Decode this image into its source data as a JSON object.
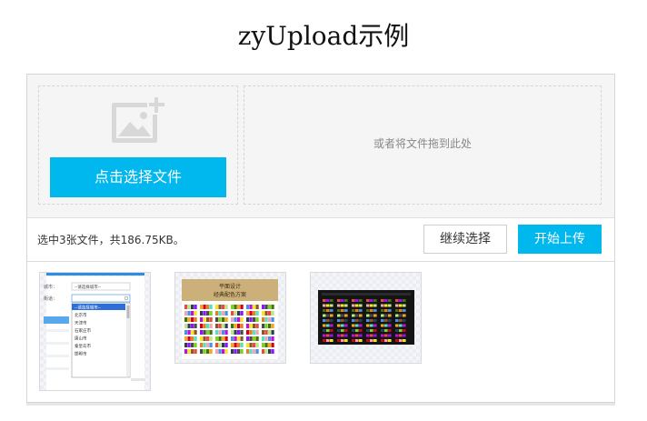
{
  "page": {
    "title": "zyUpload示例"
  },
  "uploader": {
    "select_button_label": "点击选择文件",
    "drop_hint": "或者将文件拖到此处",
    "status_text": "选中3张文件，共186.75KB。",
    "continue_label": "继续选择",
    "start_label": "开始上传"
  },
  "thumbs": {
    "thumb1": {
      "city_label": "城市：",
      "district_label": "街道：",
      "select_placeholder": "--请选择城市--",
      "options": [
        "--请选择城市--",
        "北京市",
        "天津市",
        "石家庄市",
        "唐山市",
        "秦皇岛市",
        "邯郸市"
      ]
    },
    "thumb2": {
      "title_line1": "平面设计",
      "title_line2": "经典配色方案"
    }
  },
  "colors": {
    "accent": "#00b7ee",
    "drop_text": "#888888",
    "border": "#d6d6d6"
  },
  "icons": {
    "placeholder": "image-add-icon"
  }
}
